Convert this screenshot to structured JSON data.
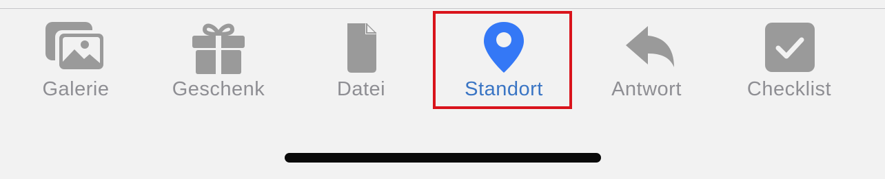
{
  "colors": {
    "background": "#f2f2f2",
    "inactive": "#8e8e93",
    "icon_inactive": "#9a9a9a",
    "active": "#3a75c4",
    "active_icon": "#3478f6",
    "highlight_border": "#d9141c",
    "home_indicator": "#0a0a0a"
  },
  "tabs": [
    {
      "label": "Galerie",
      "icon": "gallery-icon",
      "active": false
    },
    {
      "label": "Geschenk",
      "icon": "gift-icon",
      "active": false
    },
    {
      "label": "Datei",
      "icon": "file-icon",
      "active": false
    },
    {
      "label": "Standort",
      "icon": "location-pin-icon",
      "active": true
    },
    {
      "label": "Antwort",
      "icon": "reply-icon",
      "active": false
    },
    {
      "label": "Checklist",
      "icon": "checklist-icon",
      "active": false
    }
  ]
}
